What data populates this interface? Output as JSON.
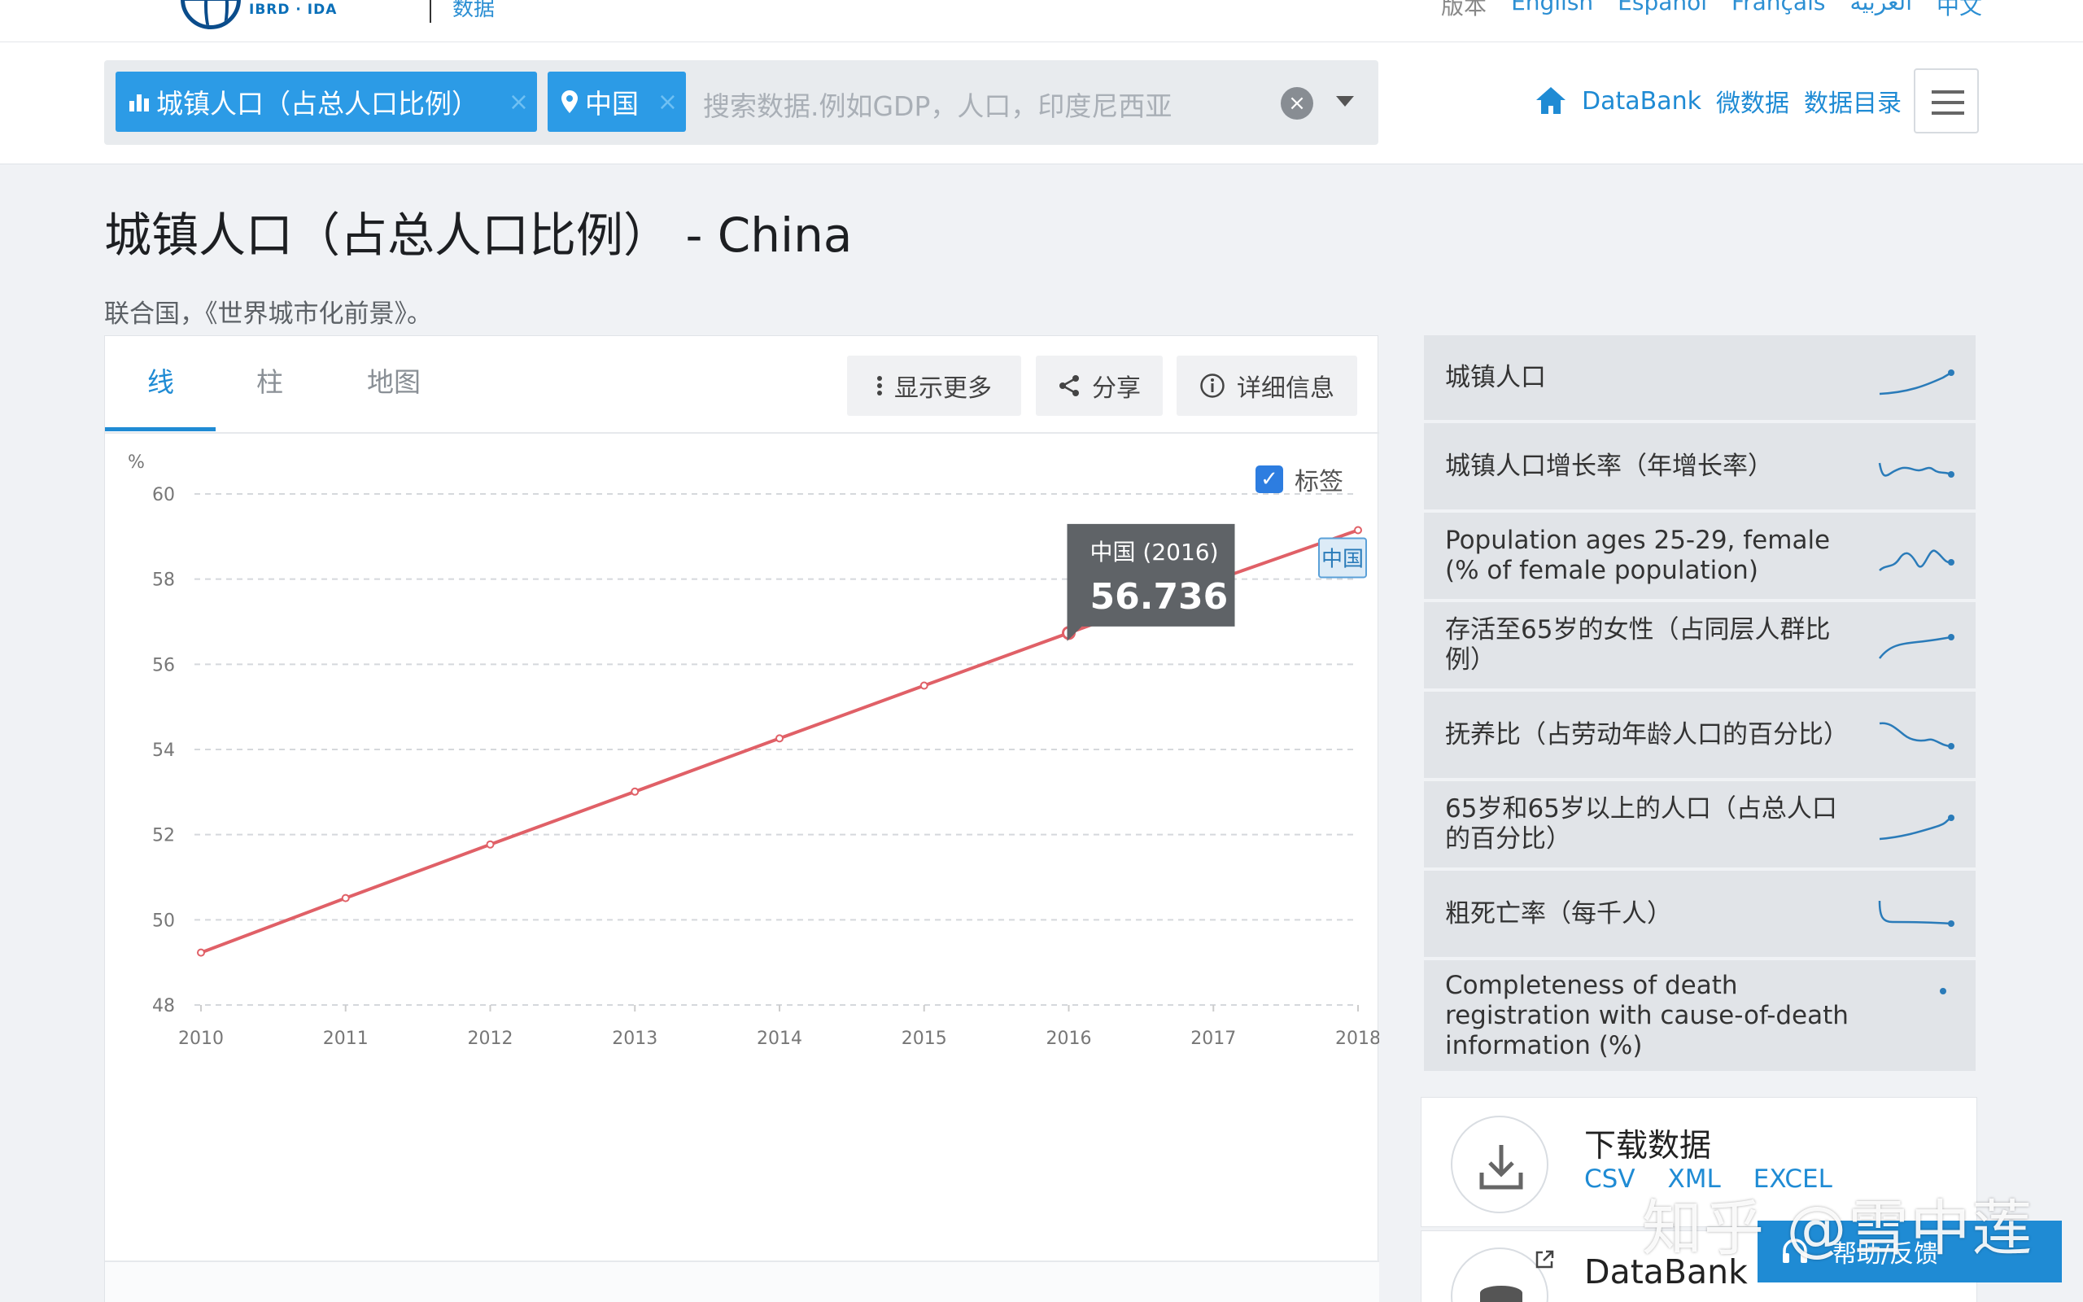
{
  "header": {
    "logo_sub": "IBRD · IDA",
    "logo_section": "数据",
    "languages": [
      "版本",
      "English",
      "Español",
      "Français",
      "العربية",
      "中文"
    ]
  },
  "search": {
    "chip_indicator": "城镇人口（占总人口比例）",
    "chip_country": "中国",
    "placeholder": "搜索数据.例如GDP，人口，印度尼西亚",
    "clear_symbol": "×",
    "chip_close": "×"
  },
  "nav": {
    "databank": "DataBank",
    "microdata": "微数据",
    "catalog": "数据目录"
  },
  "page": {
    "title": "城镇人口（占总人口比例） - China",
    "source": "联合国，《世界城市化前景》。"
  },
  "tabs": [
    "线",
    "柱",
    "地图"
  ],
  "toolbar": {
    "more": "显示更多",
    "share": "分享",
    "details": "详细信息"
  },
  "chart_controls": {
    "label_toggle": "标签",
    "checked_symbol": "✓"
  },
  "chart_data": {
    "type": "line",
    "ylabel": "%",
    "x": [
      2010,
      2011,
      2012,
      2013,
      2014,
      2015,
      2016,
      2017,
      2018
    ],
    "y_ticks": [
      48,
      50,
      52,
      54,
      56,
      58,
      60
    ],
    "ylim": [
      48,
      60
    ],
    "grid": true,
    "series": [
      {
        "name": "中国",
        "color": "#e06067",
        "values": [
          49.23,
          50.51,
          51.77,
          53.01,
          54.26,
          55.5,
          56.736,
          57.96,
          59.15
        ]
      }
    ],
    "tooltip": {
      "label": "中国 (2016)",
      "value": "56.736",
      "x": 2016
    },
    "end_label": "中国"
  },
  "sidebar": {
    "items": [
      {
        "label": "城镇人口",
        "spark": "rising"
      },
      {
        "label": "城镇人口增长率（年增长率）",
        "spark": "wavy-down"
      },
      {
        "label": "Population ages 25-29, female (% of female population)",
        "spark": "wavy-up"
      },
      {
        "label": "存活至65岁的女性（占同层人群比例）",
        "spark": "rising-flat"
      },
      {
        "label": "抚养比（占劳动年龄人口的百分比）",
        "spark": "falling"
      },
      {
        "label": "65岁和65岁以上的人口（占总人口的百分比）",
        "spark": "rising"
      },
      {
        "label": "粗死亡率（每千人）",
        "spark": "flat"
      },
      {
        "label": "Completeness of death registration with cause-of-death information (%)",
        "spark": "dot"
      }
    ],
    "spark_color": "#2a7bb9"
  },
  "download": {
    "title": "下载数据",
    "links": [
      "CSV",
      "XML",
      "EXCEL"
    ]
  },
  "databank_card": {
    "title": "DataBank"
  },
  "help": {
    "label": "帮助/反馈"
  },
  "watermark": "知乎 @雪中莲"
}
